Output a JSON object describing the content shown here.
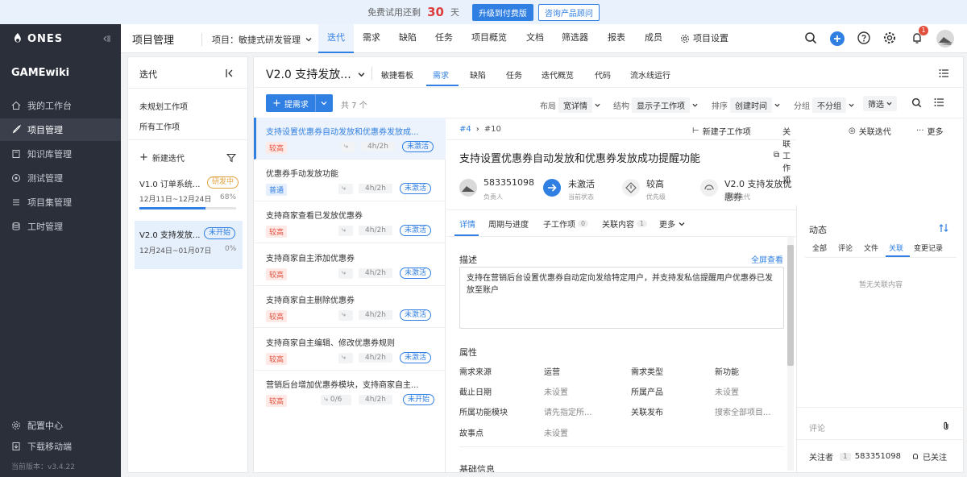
{
  "banner": {
    "prefix": "免费试用还剩",
    "days": "30",
    "suffix": "天",
    "upgrade": "升级到付费版",
    "consult": "咨询产品顾问"
  },
  "sidebar": {
    "logo": "ONES",
    "workspace": "GAMEwiki",
    "items": [
      {
        "label": "我的工作台",
        "icon": "home-icon"
      },
      {
        "label": "项目管理",
        "icon": "rocket-icon"
      },
      {
        "label": "知识库管理",
        "icon": "book-icon"
      },
      {
        "label": "测试管理",
        "icon": "target-icon"
      },
      {
        "label": "项目集管理",
        "icon": "stack-icon"
      },
      {
        "label": "工时管理",
        "icon": "database-icon"
      }
    ],
    "bottom": [
      {
        "label": "配置中心",
        "icon": "gear-icon"
      },
      {
        "label": "下载移动端",
        "icon": "download-icon"
      }
    ],
    "version": "当前版本：v3.4.22"
  },
  "topnav": {
    "title": "项目管理",
    "project": "项目：敏捷式研发管理",
    "tabs": [
      "迭代",
      "需求",
      "缺陷",
      "任务",
      "项目概览",
      "文档",
      "筛选器",
      "报表",
      "成员",
      "项目设置"
    ],
    "notify_count": "1"
  },
  "iter": {
    "header": "迭代",
    "links": [
      "未规划工作项",
      "所有工作项"
    ],
    "new_label": "新建迭代",
    "items": [
      {
        "name": "V1.0 订单系统...",
        "badge": "研发中",
        "dates": "12月11日~12月24日",
        "pct": "68%",
        "progress": 0.68
      },
      {
        "name": "V2.0 支持发放...",
        "badge": "未开始",
        "dates": "12月24日~01月07日",
        "pct": "0%",
        "progress": 0
      }
    ]
  },
  "main": {
    "iter_title": "V2.0 支持发放...",
    "tabs": [
      "敏捷看板",
      "需求",
      "缺陷",
      "任务",
      "迭代概览",
      "代码",
      "流水线运行"
    ],
    "add_btn": "提需求",
    "total": "共 7 个",
    "toolbar": {
      "layout_l": "布局",
      "layout_v": "宽详情",
      "struct_l": "结构",
      "struct_v": "显示子工作项",
      "sort_l": "排序",
      "sort_v": "创建时间",
      "group_l": "分组",
      "group_v": "不分组",
      "filter": "筛选"
    }
  },
  "list": [
    {
      "title": "支持设置优惠券自动发放和优惠券发放成...",
      "prio": "较高",
      "est": "4h/2h",
      "status": "未激活",
      "sub": ""
    },
    {
      "title": "优惠券手动发放功能",
      "prio": "普通",
      "est": "4h/2h",
      "status": "未激活",
      "sub": ""
    },
    {
      "title": "支持商家查看已发放优惠券",
      "prio": "较高",
      "est": "4h/2h",
      "status": "未激活",
      "sub": ""
    },
    {
      "title": "支持商家自主添加优惠券",
      "prio": "较高",
      "est": "4h/2h",
      "status": "未激活",
      "sub": ""
    },
    {
      "title": "支持商家自主删除优惠券",
      "prio": "较高",
      "est": "4h/2h",
      "status": "未激活",
      "sub": ""
    },
    {
      "title": "支持商家自主编辑、修改优惠券规则",
      "prio": "较高",
      "est": "4h/2h",
      "status": "未激活",
      "sub": ""
    },
    {
      "title": "营销后台增加优惠券模块，支持商家自主...",
      "prio": "较高",
      "est": "4h/2h",
      "status": "未开始",
      "sub": "0/6"
    }
  ],
  "detail": {
    "crumb_parent": "#4",
    "crumb_id": "#10",
    "actions": [
      "新建子工作项",
      "关联工作项",
      "关联迭代",
      "更多"
    ],
    "title": "支持设置优惠券自动发放和优惠券发放成功提醒功能",
    "meta": [
      {
        "value": "583351098",
        "label": "负责人"
      },
      {
        "value": "未激活",
        "label": "当前状态"
      },
      {
        "value": "较高",
        "label": "优先级"
      },
      {
        "value": "V2.0 支持发放优惠券",
        "label": "所属迭代"
      }
    ],
    "tabs": [
      {
        "label": "详情"
      },
      {
        "label": "周期与进度"
      },
      {
        "label": "子工作项",
        "count": "0"
      },
      {
        "label": "关联内容",
        "count": "1"
      },
      {
        "label": "更多"
      }
    ],
    "desc_label": "描述",
    "fullscreen": "全屏查看",
    "desc_text": "支持在营销后台设置优惠券自动定向发给特定用户，并支持发私信提醒用户优惠券已发放至账户",
    "props_label": "属性",
    "props": [
      {
        "k": "需求来源",
        "v": "运营"
      },
      {
        "k": "需求类型",
        "v": "新功能"
      },
      {
        "k": "截止日期",
        "v": "未设置"
      },
      {
        "k": "所属产品",
        "v": "未设置"
      },
      {
        "k": "所属功能模块",
        "v": "请先指定所..."
      },
      {
        "k": "关联发布",
        "v": "搜索全部项目..."
      },
      {
        "k": "故事点",
        "v": "未设置"
      }
    ],
    "basic_label": "基础信息"
  },
  "activity": {
    "title": "动态",
    "tabs": [
      "全部",
      "评论",
      "文件",
      "关联",
      "变更记录"
    ],
    "empty": "暂无关联内容",
    "comment_ph": "评论",
    "watcher_label": "关注者",
    "watcher_count": "1",
    "watcher_name": "583351098",
    "watched": "已关注"
  }
}
